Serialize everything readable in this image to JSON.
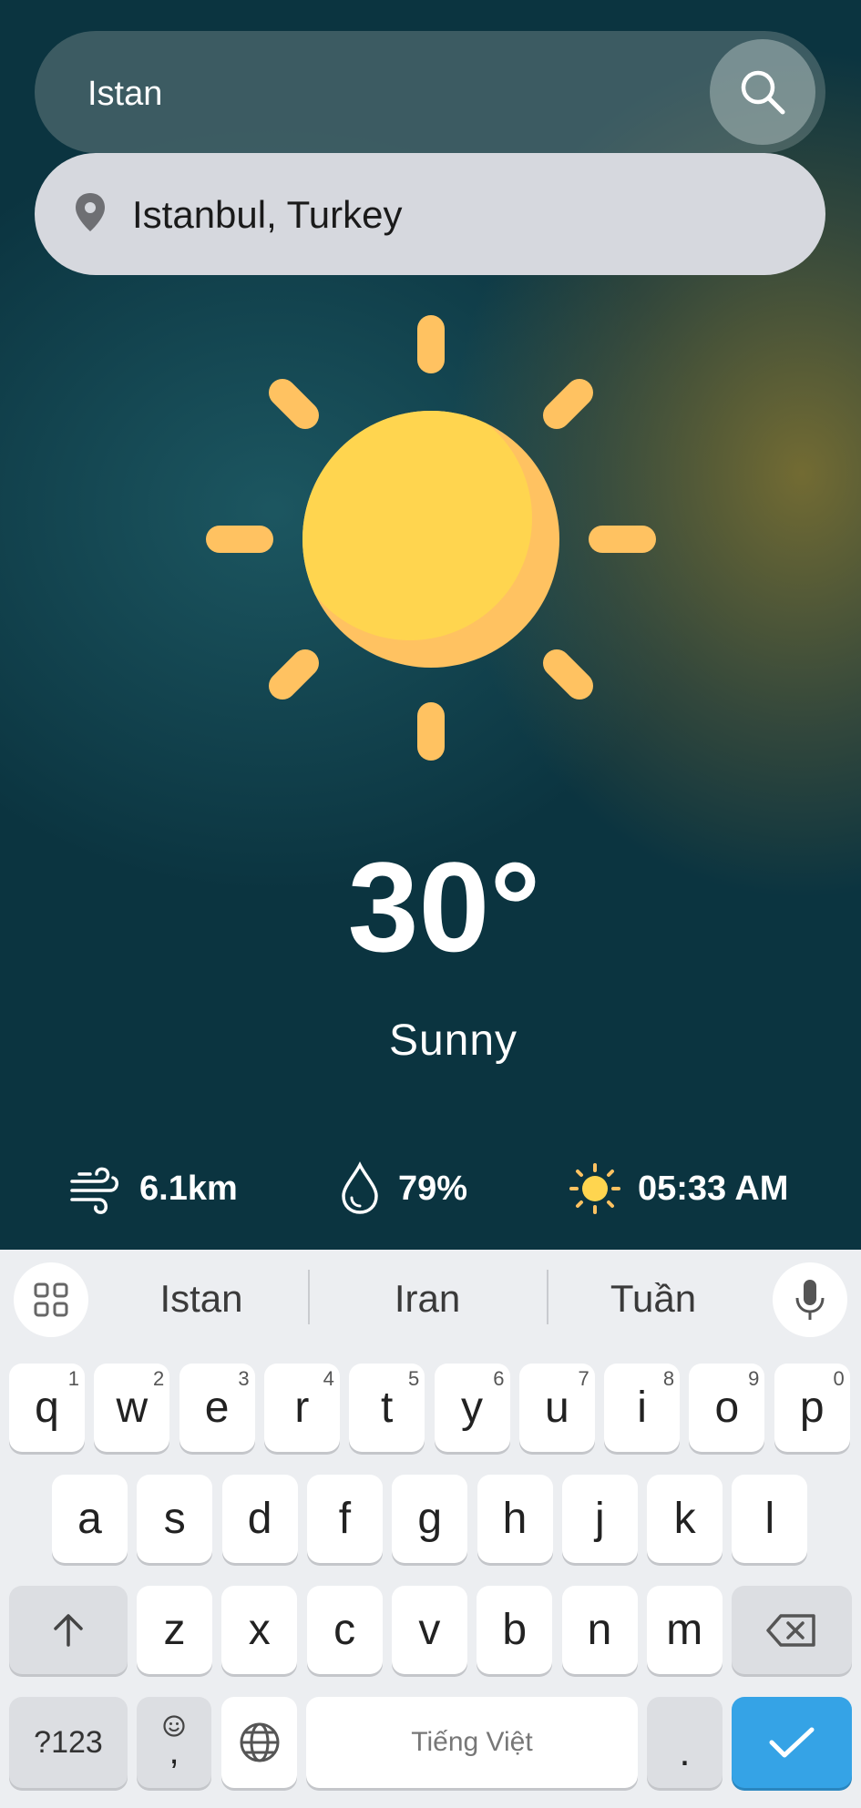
{
  "search": {
    "query": "Istan"
  },
  "suggestion": {
    "label": "Istanbul, Turkey"
  },
  "weather": {
    "temperature": "30°",
    "condition": "Sunny",
    "wind": "6.1km",
    "humidity": "79%",
    "sunrise": "05:33 AM"
  },
  "keyboard": {
    "suggestions": [
      "Istan",
      "Iran",
      "Tuần"
    ],
    "row1": [
      [
        "q",
        "1"
      ],
      [
        "w",
        "2"
      ],
      [
        "e",
        "3"
      ],
      [
        "r",
        "4"
      ],
      [
        "t",
        "5"
      ],
      [
        "y",
        "6"
      ],
      [
        "u",
        "7"
      ],
      [
        "i",
        "8"
      ],
      [
        "o",
        "9"
      ],
      [
        "p",
        "0"
      ]
    ],
    "row2": [
      "a",
      "s",
      "d",
      "f",
      "g",
      "h",
      "j",
      "k",
      "l"
    ],
    "row3": [
      "z",
      "x",
      "c",
      "v",
      "b",
      "n",
      "m"
    ],
    "symbols_label": "?123",
    "comma_label": ",",
    "space_label": "Tiếng Việt",
    "period_label": "."
  },
  "colors": {
    "sun": "#FFD54F",
    "sun_shade": "#FFC261",
    "accent": "#35A3E6"
  }
}
